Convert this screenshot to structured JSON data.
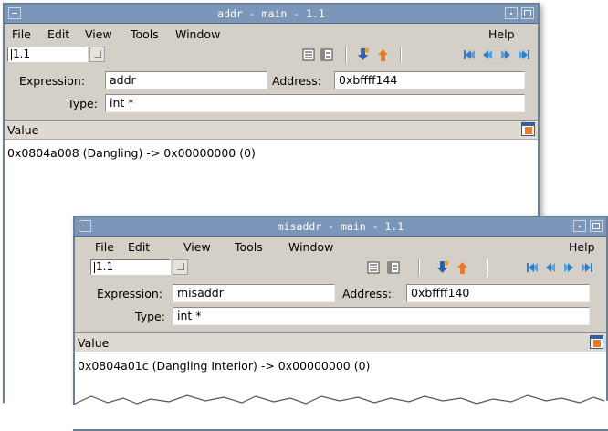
{
  "windows": [
    {
      "title": "addr - main - 1.1",
      "menu": [
        "File",
        "Edit",
        "View",
        "Tools",
        "Window",
        "Help"
      ],
      "frame_value": "1.1",
      "expression_label": "Expression:",
      "expression_value": "addr",
      "address_label": "Address:",
      "address_value": "0xbffff144",
      "type_label": "Type:",
      "type_value": "int *",
      "value_header": "Value",
      "value_text": "0x0804a008 (Dangling) -> 0x00000000 (0)"
    },
    {
      "title": "misaddr - main - 1.1",
      "menu": [
        "File",
        "Edit",
        "View",
        "Tools",
        "Window",
        "Help"
      ],
      "frame_value": "1.1",
      "expression_label": "Expression:",
      "expression_value": "misaddr",
      "address_label": "Address:",
      "address_value": "0xbffff140",
      "type_label": "Type:",
      "type_value": "int *",
      "value_header": "Value",
      "value_text": "0x0804a01c (Dangling Interior) -> 0x00000000 (0)"
    }
  ],
  "colors": {
    "titlebar": "#7b96b8",
    "window_bg": "#d4d0c8",
    "icon_blue": "#2f5fa8",
    "icon_orange": "#e87a2a"
  }
}
